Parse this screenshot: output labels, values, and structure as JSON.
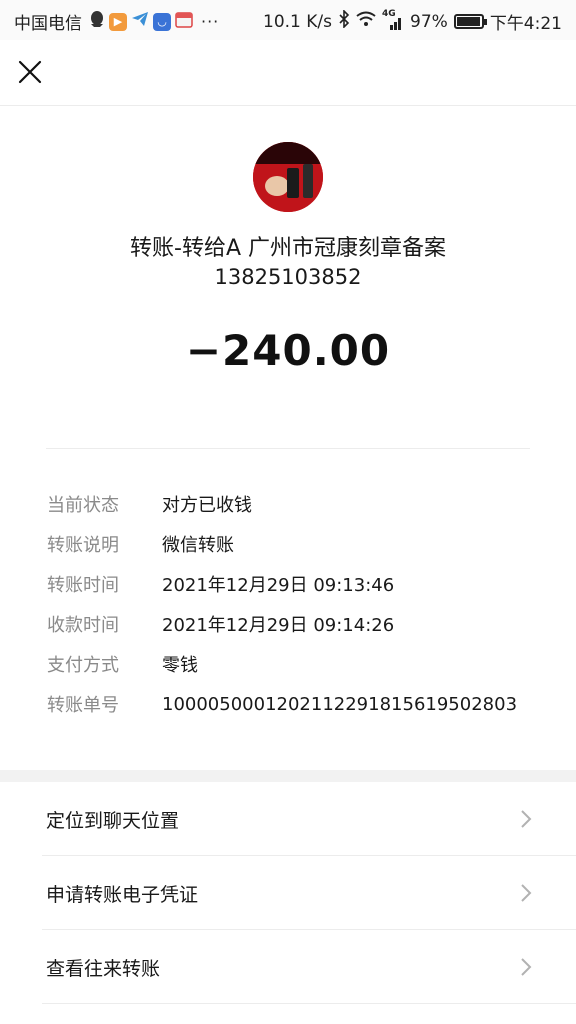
{
  "status_bar": {
    "carrier": "中国电信",
    "net_speed": "10.1 K/s",
    "network": "4G",
    "battery_percent": "97%",
    "battery_level": 0.97,
    "time": "下午4:21",
    "more": "···"
  },
  "summary": {
    "title": "转账-转给A 广州市冠康刻章备案",
    "phone": "13825103852",
    "amount": "−240.00"
  },
  "details": {
    "rows": [
      {
        "label": "当前状态",
        "value": "对方已收钱"
      },
      {
        "label": "转账说明",
        "value": "微信转账"
      },
      {
        "label": "转账时间",
        "value": "2021年12月29日 09:13:46"
      },
      {
        "label": "收款时间",
        "value": "2021年12月29日 09:14:26"
      },
      {
        "label": "支付方式",
        "value": "零钱"
      },
      {
        "label": "转账单号",
        "value": "1000050001202112291815619502803"
      }
    ]
  },
  "actions": [
    {
      "label": "定位到聊天位置"
    },
    {
      "label": "申请转账电子凭证"
    },
    {
      "label": "查看往来转账"
    }
  ],
  "colors": {
    "label_gray": "#8a8a8a",
    "text": "#191919",
    "band": "#f2f2f2",
    "avatar_red": "#c8181c"
  }
}
